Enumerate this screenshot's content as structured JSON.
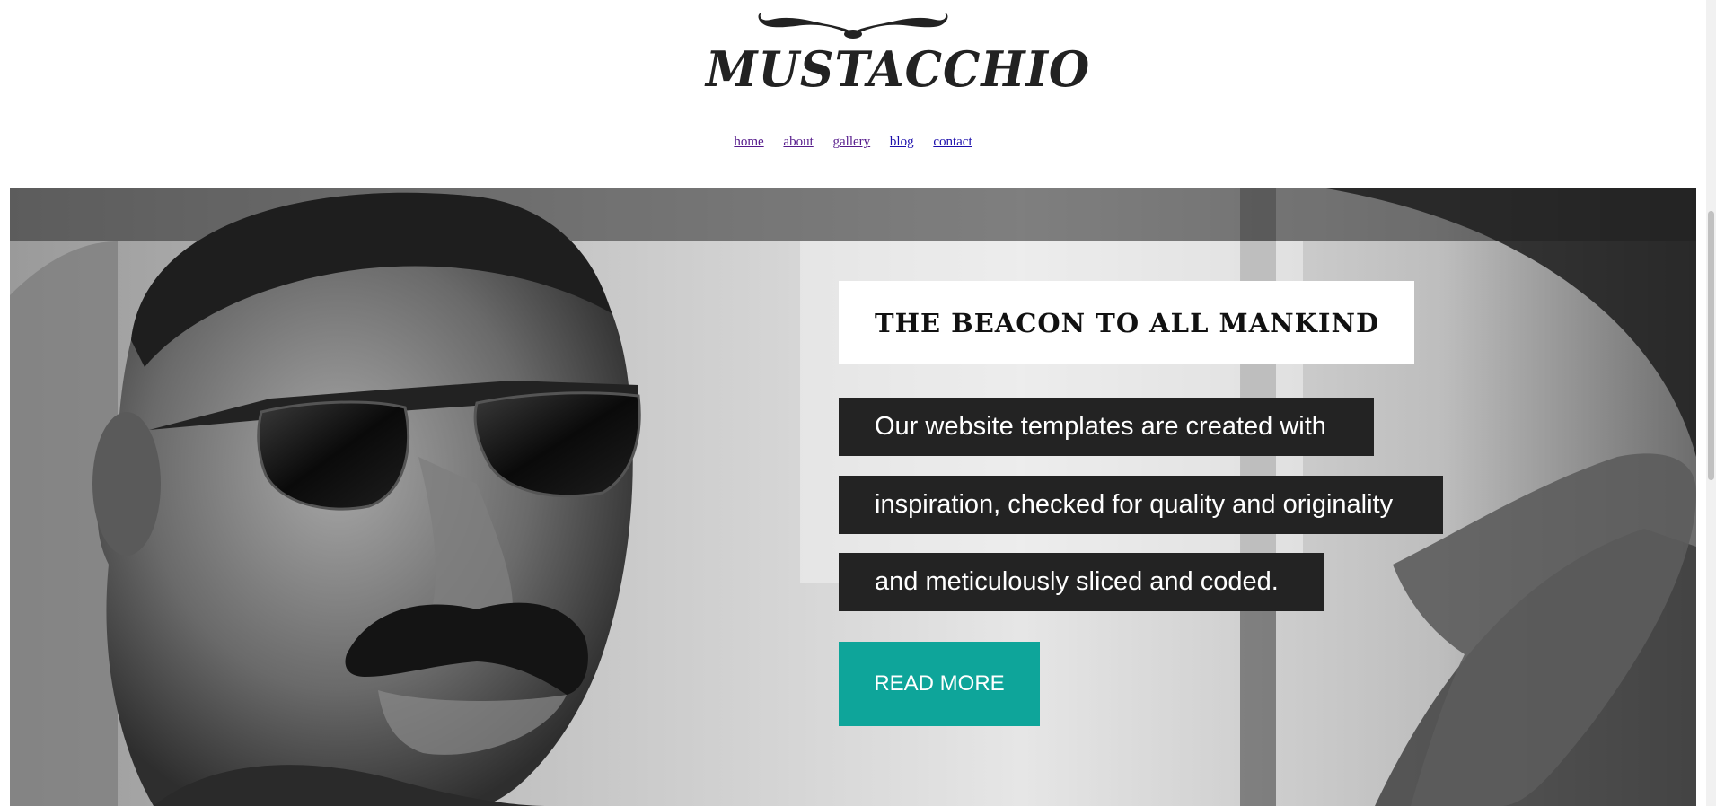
{
  "logo": {
    "text": "MUSTACCHIO",
    "icon": "mustache-icon"
  },
  "nav": {
    "items": [
      {
        "label": "home"
      },
      {
        "label": "about"
      },
      {
        "label": "gallery"
      },
      {
        "label": "blog"
      },
      {
        "label": "contact"
      }
    ]
  },
  "hero": {
    "headline": "THE BEACON TO ALL MANKIND",
    "lines": [
      "Our website templates are created with",
      "inspiration, checked for quality and originality",
      "and meticulously sliced and coded."
    ],
    "button_label": "READ MORE",
    "image": "black-and-white-photo-man-sunglasses-mustache-driving"
  },
  "colors": {
    "accent": "#0ea59a",
    "text_box_bg": "#232323",
    "logo": "#222222",
    "link": "#1a0dab",
    "link_visited": "#551a8b"
  }
}
